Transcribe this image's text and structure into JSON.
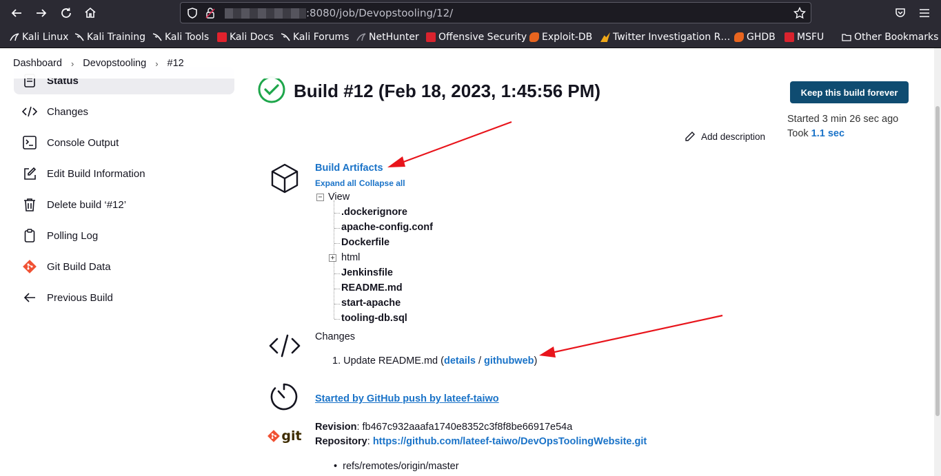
{
  "browser": {
    "url_text": ":8080/job/Devopstooling/12/",
    "bookmarks": [
      {
        "label": "Kali Linux",
        "icon": "kali-dragon-icon"
      },
      {
        "label": "Kali Training",
        "icon": "kali-dragon-icon"
      },
      {
        "label": "Kali Tools",
        "icon": "kali-dragon-icon"
      },
      {
        "label": "Kali Docs",
        "icon": "kali-docs-icon"
      },
      {
        "label": "Kali Forums",
        "icon": "kali-dragon-icon"
      },
      {
        "label": "NetHunter",
        "icon": "nethunter-icon"
      },
      {
        "label": "Offensive Security",
        "icon": "offsec-icon"
      },
      {
        "label": "Exploit-DB",
        "icon": "exploitdb-icon"
      },
      {
        "label": "Twitter Investigation R…",
        "icon": "twitter-investigation-icon"
      },
      {
        "label": "GHDB",
        "icon": "ghdb-icon"
      },
      {
        "label": "MSFU",
        "icon": "offsec-icon"
      },
      {
        "label": "Other Bookmarks",
        "icon": "folder-icon"
      }
    ]
  },
  "breadcrumb": [
    "Dashboard",
    "Devopstooling",
    "#12"
  ],
  "sidebar": {
    "items": [
      {
        "label": "Status",
        "icon": "document-icon"
      },
      {
        "label": "Changes",
        "icon": "code-icon"
      },
      {
        "label": "Console Output",
        "icon": "terminal-icon"
      },
      {
        "label": "Edit Build Information",
        "icon": "edit-icon"
      },
      {
        "label": "Delete build ‘#12’",
        "icon": "trash-icon"
      },
      {
        "label": "Polling Log",
        "icon": "clipboard-icon"
      },
      {
        "label": "Git Build Data",
        "icon": "git-icon"
      },
      {
        "label": "Previous Build",
        "icon": "arrow-left-icon"
      }
    ]
  },
  "build": {
    "title": "Build #12 (Feb 18, 2023, 1:45:56 PM)",
    "keep_label": "Keep this build forever",
    "started": "Started 3 min 26 sec ago",
    "took_prefix": "Took ",
    "took_value": "1.1 sec",
    "add_description": "Add description"
  },
  "artifacts": {
    "title": "Build Artifacts",
    "expand_all": "Expand all",
    "collapse_all": "Collapse all",
    "root": "View",
    "files": [
      {
        "name": ".dockerignore",
        "dir": false
      },
      {
        "name": "apache-config.conf",
        "dir": false
      },
      {
        "name": "Dockerfile",
        "dir": false
      },
      {
        "name": "html",
        "dir": true
      },
      {
        "name": "Jenkinsfile",
        "dir": false
      },
      {
        "name": "README.md",
        "dir": false
      },
      {
        "name": "start-apache",
        "dir": false
      },
      {
        "name": "tooling-db.sql",
        "dir": false
      }
    ]
  },
  "changes": {
    "title": "Changes",
    "number": "1.",
    "message": "Update README.md (",
    "details": "details",
    "slash": " / ",
    "githubweb": "githubweb",
    "close": ")"
  },
  "cause": "Started by GitHub push by lateef-taiwo",
  "git": {
    "revision_label": "Revision",
    "revision_value": ": fb467c932aaafa1740e8352c3f8f8be66917e54a",
    "repository_label": "Repository",
    "repository_sep": ": ",
    "repository_url": "https://github.com/lateef-taiwo/DevOpsToolingWebsite.git",
    "ref": "refs/remotes/origin/master",
    "logo_text": "git"
  },
  "colors": {
    "accent_blue": "#1a73c8",
    "keep_button": "#0f4c71",
    "success_green": "#1ea64b",
    "annotation_red": "#e8141b",
    "git_orange": "#f05133"
  }
}
